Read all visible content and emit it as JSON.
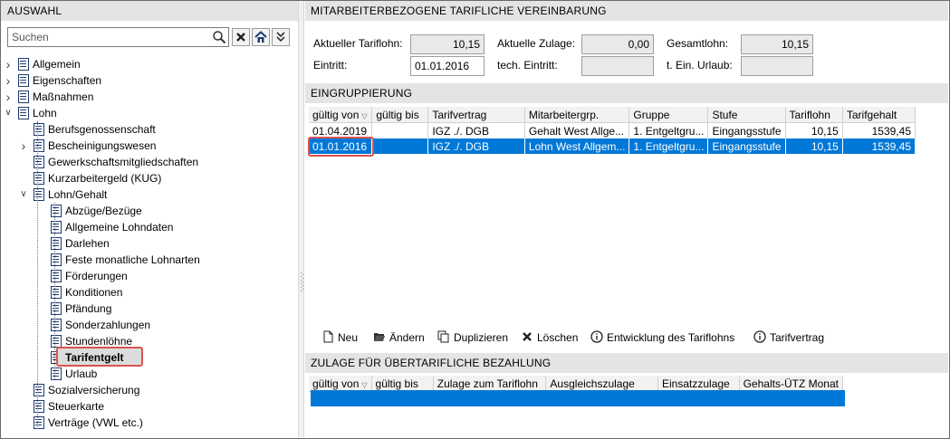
{
  "left_panel": {
    "title": "AUSWAHL",
    "search_placeholder": "Suchen",
    "tree": [
      {
        "label": "Allgemein",
        "level": 0,
        "expander": "collapsed"
      },
      {
        "label": "Eigenschaften",
        "level": 0,
        "expander": "collapsed"
      },
      {
        "label": "Maßnahmen",
        "level": 0,
        "expander": "collapsed"
      },
      {
        "label": "Lohn",
        "level": 0,
        "expander": "expanded"
      },
      {
        "label": "Berufsgenossenschaft",
        "level": 1
      },
      {
        "label": "Bescheinigungswesen",
        "level": 1,
        "expander": "collapsed"
      },
      {
        "label": "Gewerkschaftsmitgliedschaften",
        "level": 1
      },
      {
        "label": "Kurzarbeitergeld (KUG)",
        "level": 1
      },
      {
        "label": "Lohn/Gehalt",
        "level": 1,
        "expander": "expanded"
      },
      {
        "label": "Abzüge/Bezüge",
        "level": 2
      },
      {
        "label": "Allgemeine Lohndaten",
        "level": 2
      },
      {
        "label": "Darlehen",
        "level": 2
      },
      {
        "label": "Feste monatliche Lohnarten",
        "level": 2
      },
      {
        "label": "Förderungen",
        "level": 2
      },
      {
        "label": "Konditionen",
        "level": 2
      },
      {
        "label": "Pfändung",
        "level": 2
      },
      {
        "label": "Sonderzahlungen",
        "level": 2
      },
      {
        "label": "Stundenlöhne",
        "level": 2
      },
      {
        "label": "Tarifentgelt",
        "level": 2,
        "selected": true
      },
      {
        "label": "Urlaub",
        "level": 2
      },
      {
        "label": "Sozialversicherung",
        "level": 1
      },
      {
        "label": "Steuerkarte",
        "level": 1
      },
      {
        "label": "Verträge (VWL etc.)",
        "level": 1
      }
    ]
  },
  "right_panel": {
    "title": "MITARBEITERBEZOGENE TARIFLICHE VEREINBARUNG",
    "fields": {
      "aktueller_tariflohn_label": "Aktueller Tariflohn:",
      "aktueller_tariflohn_value": "10,15",
      "aktuelle_zulage_label": "Aktuelle Zulage:",
      "aktuelle_zulage_value": "0,00",
      "gesamtlohn_label": "Gesamtlohn:",
      "gesamtlohn_value": "10,15",
      "eintritt_label": "Eintritt:",
      "eintritt_value": "01.01.2016",
      "tech_eintritt_label": "tech. Eintritt:",
      "tech_eintritt_value": "",
      "t_ein_urlaub_label": "t. Ein. Urlaub:",
      "t_ein_urlaub_value": ""
    },
    "eingruppierung": {
      "title": "EINGRUPPIERUNG",
      "columns": [
        "gültig von",
        "gültig bis",
        "Tarifvertrag",
        "Mitarbeitergrp.",
        "Gruppe",
        "Stufe",
        "Tariflohn",
        "Tarifgehalt"
      ],
      "rows": [
        [
          "01.04.2019",
          "",
          "IGZ ./. DGB",
          "Gehalt West Allge...",
          "1. Entgeltgru...",
          "Eingangsstufe",
          "10,15",
          "1539,45"
        ],
        [
          "01.01.2016",
          "",
          "IGZ ./. DGB",
          "Lohn West Allgem...",
          "1. Entgeltgru...",
          "Eingangsstufe",
          "10,15",
          "1539,45"
        ]
      ],
      "selected_row": 1
    },
    "toolbar": {
      "neu": "Neu",
      "aendern": "Ändern",
      "duplizieren": "Duplizieren",
      "loeschen": "Löschen",
      "entwicklung": "Entwicklung des Tariflohns",
      "tarifvertrag": "Tarifvertrag"
    },
    "zulage": {
      "title": "ZULAGE FÜR ÜBERTARIFLICHE BEZAHLUNG",
      "columns": [
        "gültig von",
        "gültig bis",
        "Zulage zum Tariflohn",
        "Ausgleichszulage",
        "Einsatzzulage",
        "Gehalts-ÜTZ Monat"
      ]
    }
  },
  "colors": {
    "selection": "#0078d7",
    "highlight": "#d9534f",
    "header_bg": "#e4e4e4"
  }
}
